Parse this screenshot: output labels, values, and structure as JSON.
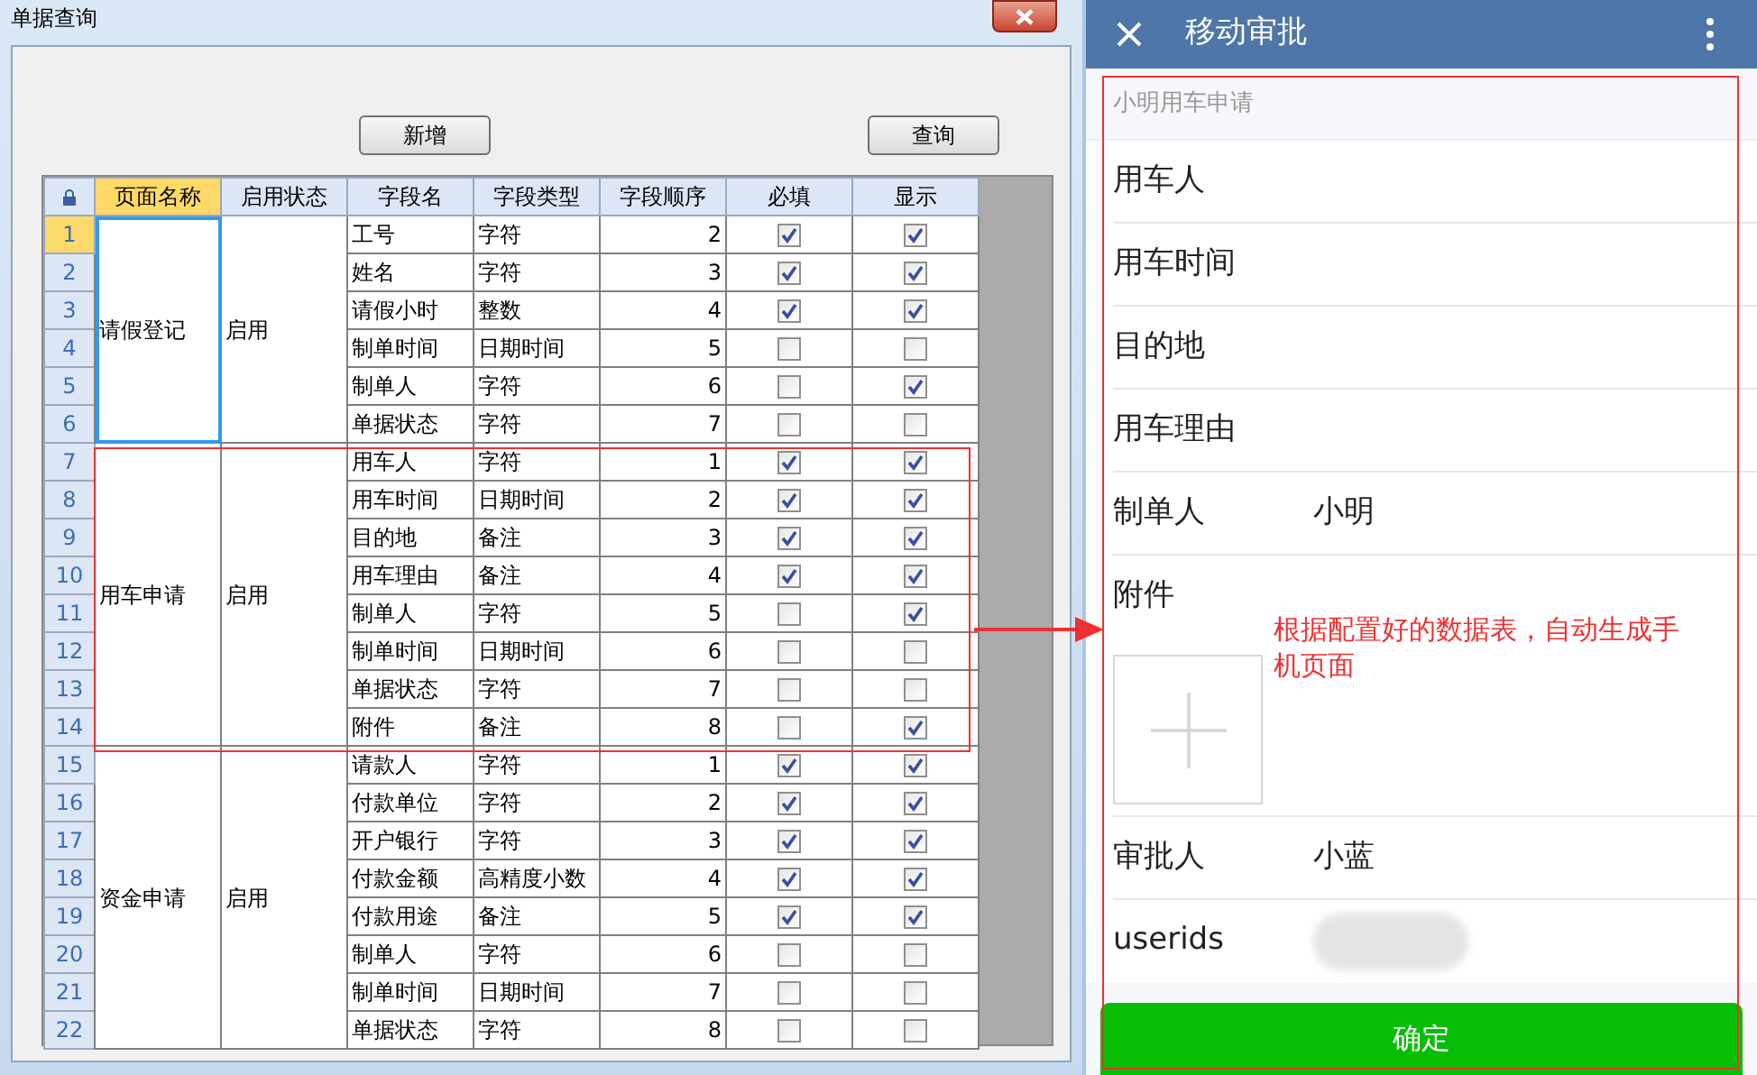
{
  "window": {
    "title": "单据查询"
  },
  "buttons": [
    {
      "label": "新增",
      "kind": "add"
    },
    {
      "label": "查询",
      "kind": "query"
    }
  ],
  "table": {
    "columns": [
      {
        "label": "页面名称",
        "selected": true
      },
      {
        "label": "启用状态",
        "selected": false
      },
      {
        "label": "字段名",
        "selected": false
      },
      {
        "label": "字段类型",
        "selected": false
      },
      {
        "label": "字段顺序",
        "selected": false
      },
      {
        "label": "必填",
        "selected": false
      },
      {
        "label": "显示",
        "selected": false
      }
    ],
    "groups": [
      {
        "page_name": "请假登记",
        "status": "启用",
        "selected": true,
        "rows": [
          {
            "number": "1",
            "selected": true,
            "field": "工号",
            "type": "字符",
            "order": "2",
            "required": true,
            "shown": true
          },
          {
            "number": "2",
            "selected": false,
            "field": "姓名",
            "type": "字符",
            "order": "3",
            "required": true,
            "shown": true
          },
          {
            "number": "3",
            "selected": false,
            "field": "请假小时",
            "type": "整数",
            "order": "4",
            "required": true,
            "shown": true
          },
          {
            "number": "4",
            "selected": false,
            "field": "制单时间",
            "type": "日期时间",
            "order": "5",
            "required": false,
            "shown": false
          },
          {
            "number": "5",
            "selected": false,
            "field": "制单人",
            "type": "字符",
            "order": "6",
            "required": false,
            "shown": true
          },
          {
            "number": "6",
            "selected": false,
            "field": "单据状态",
            "type": "字符",
            "order": "7",
            "required": false,
            "shown": false
          }
        ]
      },
      {
        "page_name": "用车申请",
        "status": "启用",
        "selected": false,
        "rows": [
          {
            "number": "7",
            "selected": false,
            "field": "用车人",
            "type": "字符",
            "order": "1",
            "required": true,
            "shown": true
          },
          {
            "number": "8",
            "selected": false,
            "field": "用车时间",
            "type": "日期时间",
            "order": "2",
            "required": true,
            "shown": true
          },
          {
            "number": "9",
            "selected": false,
            "field": "目的地",
            "type": "备注",
            "order": "3",
            "required": true,
            "shown": true
          },
          {
            "number": "10",
            "selected": false,
            "field": "用车理由",
            "type": "备注",
            "order": "4",
            "required": true,
            "shown": true
          },
          {
            "number": "11",
            "selected": false,
            "field": "制单人",
            "type": "字符",
            "order": "5",
            "required": false,
            "shown": true
          },
          {
            "number": "12",
            "selected": false,
            "field": "制单时间",
            "type": "日期时间",
            "order": "6",
            "required": false,
            "shown": false
          },
          {
            "number": "13",
            "selected": false,
            "field": "单据状态",
            "type": "字符",
            "order": "7",
            "required": false,
            "shown": false
          },
          {
            "number": "14",
            "selected": false,
            "field": "附件",
            "type": "备注",
            "order": "8",
            "required": false,
            "shown": true
          }
        ]
      },
      {
        "page_name": "资金申请",
        "status": "启用",
        "selected": false,
        "rows": [
          {
            "number": "15",
            "selected": false,
            "field": "请款人",
            "type": "字符",
            "order": "1",
            "required": true,
            "shown": true
          },
          {
            "number": "16",
            "selected": false,
            "field": "付款单位",
            "type": "字符",
            "order": "2",
            "required": true,
            "shown": true
          },
          {
            "number": "17",
            "selected": false,
            "field": "开户银行",
            "type": "字符",
            "order": "3",
            "required": true,
            "shown": true
          },
          {
            "number": "18",
            "selected": false,
            "field": "付款金额",
            "type": "高精度小数",
            "order": "4",
            "required": true,
            "shown": true
          },
          {
            "number": "19",
            "selected": false,
            "field": "付款用途",
            "type": "备注",
            "order": "5",
            "required": true,
            "shown": true
          },
          {
            "number": "20",
            "selected": false,
            "field": "制单人",
            "type": "字符",
            "order": "6",
            "required": false,
            "shown": false
          },
          {
            "number": "21",
            "selected": false,
            "field": "制单时间",
            "type": "日期时间",
            "order": "7",
            "required": false,
            "shown": false
          },
          {
            "number": "22",
            "selected": false,
            "field": "单据状态",
            "type": "字符",
            "order": "8",
            "required": false,
            "shown": false
          }
        ]
      }
    ]
  },
  "mobile": {
    "title": "移动审批",
    "subtitle": "小明用车申请",
    "fields": [
      {
        "kind": "text",
        "label": "用车人"
      },
      {
        "kind": "text",
        "label": "用车时间"
      },
      {
        "kind": "text",
        "label": "目的地"
      },
      {
        "kind": "text",
        "label": "用车理由"
      },
      {
        "kind": "text",
        "label": "制单人",
        "value": "小明"
      },
      {
        "kind": "upload",
        "label": "附件"
      },
      {
        "kind": "text",
        "label": "审批人",
        "value": "小蓝"
      },
      {
        "kind": "redacted",
        "label": "userids"
      }
    ],
    "confirm_button": "确定"
  },
  "annotation": "根据配置好的数据表，自动生成手机页面"
}
